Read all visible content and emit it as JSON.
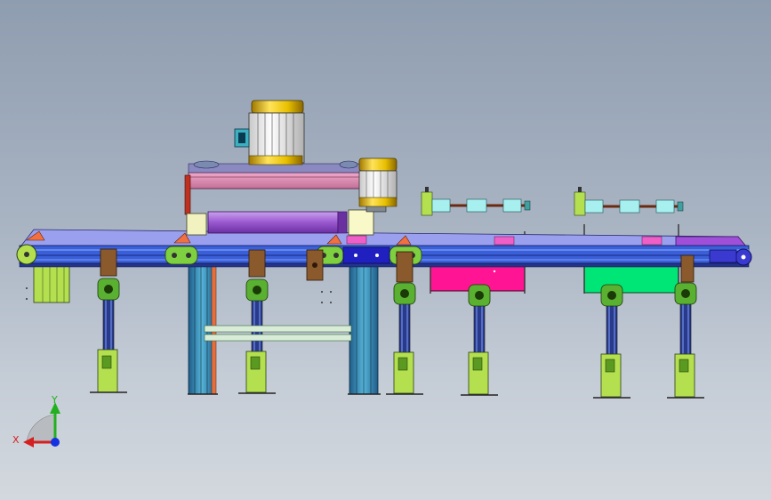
{
  "viewport": {
    "background_top": "#8f9db0",
    "background_bottom": "#d3d8de"
  },
  "triad": {
    "x_label": "X",
    "y_label": "Y",
    "x_color": "#d42020",
    "y_color": "#22b020",
    "z_color": "#1530e0"
  },
  "colors": {
    "motor_yellow": "#e8c000",
    "belt_blue": "#3a5fd8",
    "frame_lime": "#b4e050",
    "bracket_brown": "#8a5a2c",
    "tank_magenta": "#ff1493",
    "tank_green": "#00e676",
    "roller_purple": "#9a58d0",
    "roller_cyan": "#a8f0f0",
    "column_teal": "#3a8cb0"
  }
}
